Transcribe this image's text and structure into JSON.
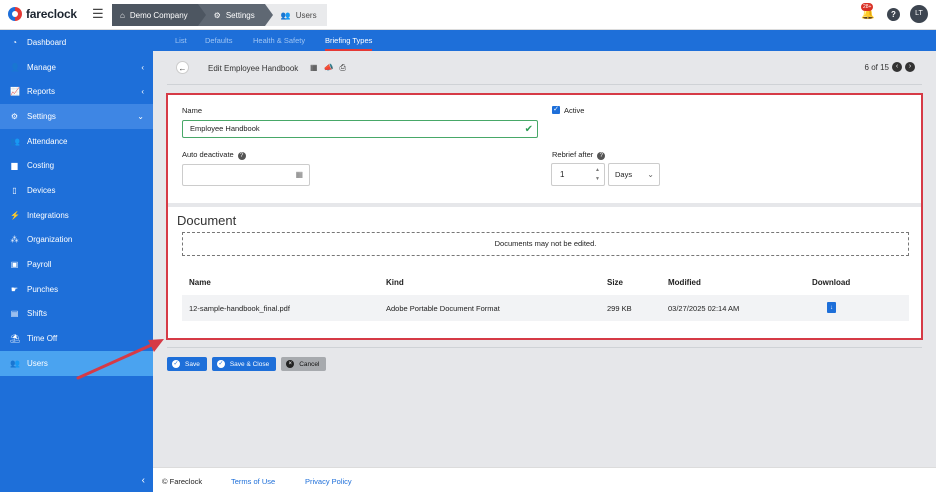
{
  "app": {
    "logo_text": "fareclock"
  },
  "breadcrumbs": [
    {
      "label": "Demo Company",
      "icon": "home-icon"
    },
    {
      "label": "Settings",
      "icon": "gear-icon"
    },
    {
      "label": "Users",
      "icon": "users-icon"
    }
  ],
  "topbar": {
    "notification_count": "28+",
    "help": "?",
    "avatar_initials": "LT"
  },
  "sidebar": {
    "items": [
      {
        "label": "Dashboard",
        "icon": "dashboard-icon"
      },
      {
        "label": "Manage",
        "icon": "person-icon",
        "chevron": "‹"
      },
      {
        "label": "Reports",
        "icon": "chart-icon",
        "chevron": "‹"
      },
      {
        "label": "Settings",
        "icon": "gear-icon",
        "chevron": "⌄"
      },
      {
        "label": "Attendance",
        "icon": "attendance-icon"
      },
      {
        "label": "Costing",
        "icon": "costing-icon"
      },
      {
        "label": "Devices",
        "icon": "device-icon"
      },
      {
        "label": "Integrations",
        "icon": "plug-icon"
      },
      {
        "label": "Organization",
        "icon": "org-icon"
      },
      {
        "label": "Payroll",
        "icon": "payroll-icon"
      },
      {
        "label": "Punches",
        "icon": "punch-icon"
      },
      {
        "label": "Shifts",
        "icon": "shift-icon"
      },
      {
        "label": "Time Off",
        "icon": "timeoff-icon"
      },
      {
        "label": "Users",
        "icon": "users-icon"
      }
    ]
  },
  "subnav": {
    "tabs": [
      "List",
      "Defaults",
      "Health & Safety",
      "Briefing Types"
    ]
  },
  "header": {
    "title": "Edit Employee Handbook",
    "pager": "6 of 15"
  },
  "form": {
    "name_label": "Name",
    "name_value": "Employee Handbook",
    "active_label": "Active",
    "auto_deactivate_label": "Auto deactivate",
    "rebrief_label": "Rebrief after",
    "rebrief_value": "1",
    "rebrief_unit": "Days"
  },
  "document": {
    "title": "Document",
    "note": "Documents may not be edited.",
    "columns": [
      "Name",
      "Kind",
      "Size",
      "Modified",
      "Download"
    ],
    "row": {
      "name": "12-sample-handbook_final.pdf",
      "kind": "Adobe Portable Document Format",
      "size": "299 KB",
      "modified": "03/27/2025 02:14 AM"
    }
  },
  "buttons": {
    "save": "Save",
    "save_close": "Save & Close",
    "cancel": "Cancel"
  },
  "footer": {
    "copyright": "© Fareclock",
    "terms": "Terms of Use",
    "privacy": "Privacy Policy"
  },
  "colors": {
    "brand_blue": "#1e6fd9",
    "highlight_red": "#d63a46"
  }
}
